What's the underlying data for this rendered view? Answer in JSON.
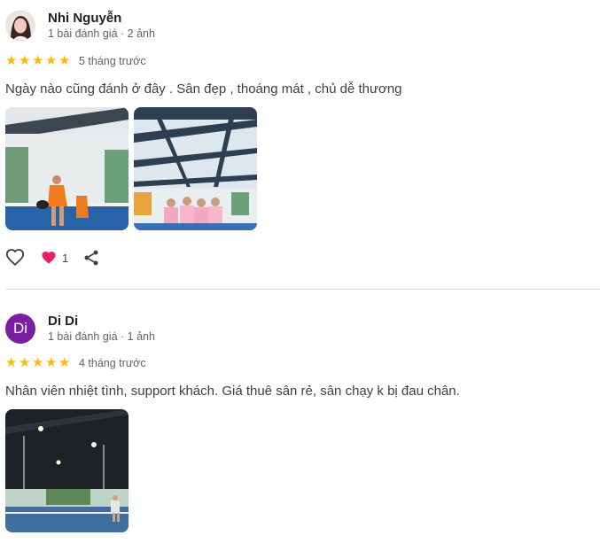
{
  "reviews": [
    {
      "author": "Nhi Nguyễn",
      "meta": "1 bài đánh giá · 2 ảnh",
      "rating": 5,
      "time": "5 tháng trước",
      "text": "Ngày nào cũng đánh ở đây . Sân đẹp , thoáng mát , chủ dễ thương",
      "likes": "1",
      "avatar_type": "photo"
    },
    {
      "author": "Di Di",
      "avatar_letter": "Di",
      "meta": "1 bài đánh giá · 1 ảnh",
      "rating": 5,
      "time": "4 tháng trước",
      "text": "Nhân viên nhiệt tình, support khách. Giá thuê sân rẻ, sân chạy k bị đau chân.",
      "avatar_type": "letter"
    }
  ],
  "colors": {
    "star": "#fbbc04",
    "heart": "#e91e63",
    "avatar_di": "#7b1fa2"
  }
}
